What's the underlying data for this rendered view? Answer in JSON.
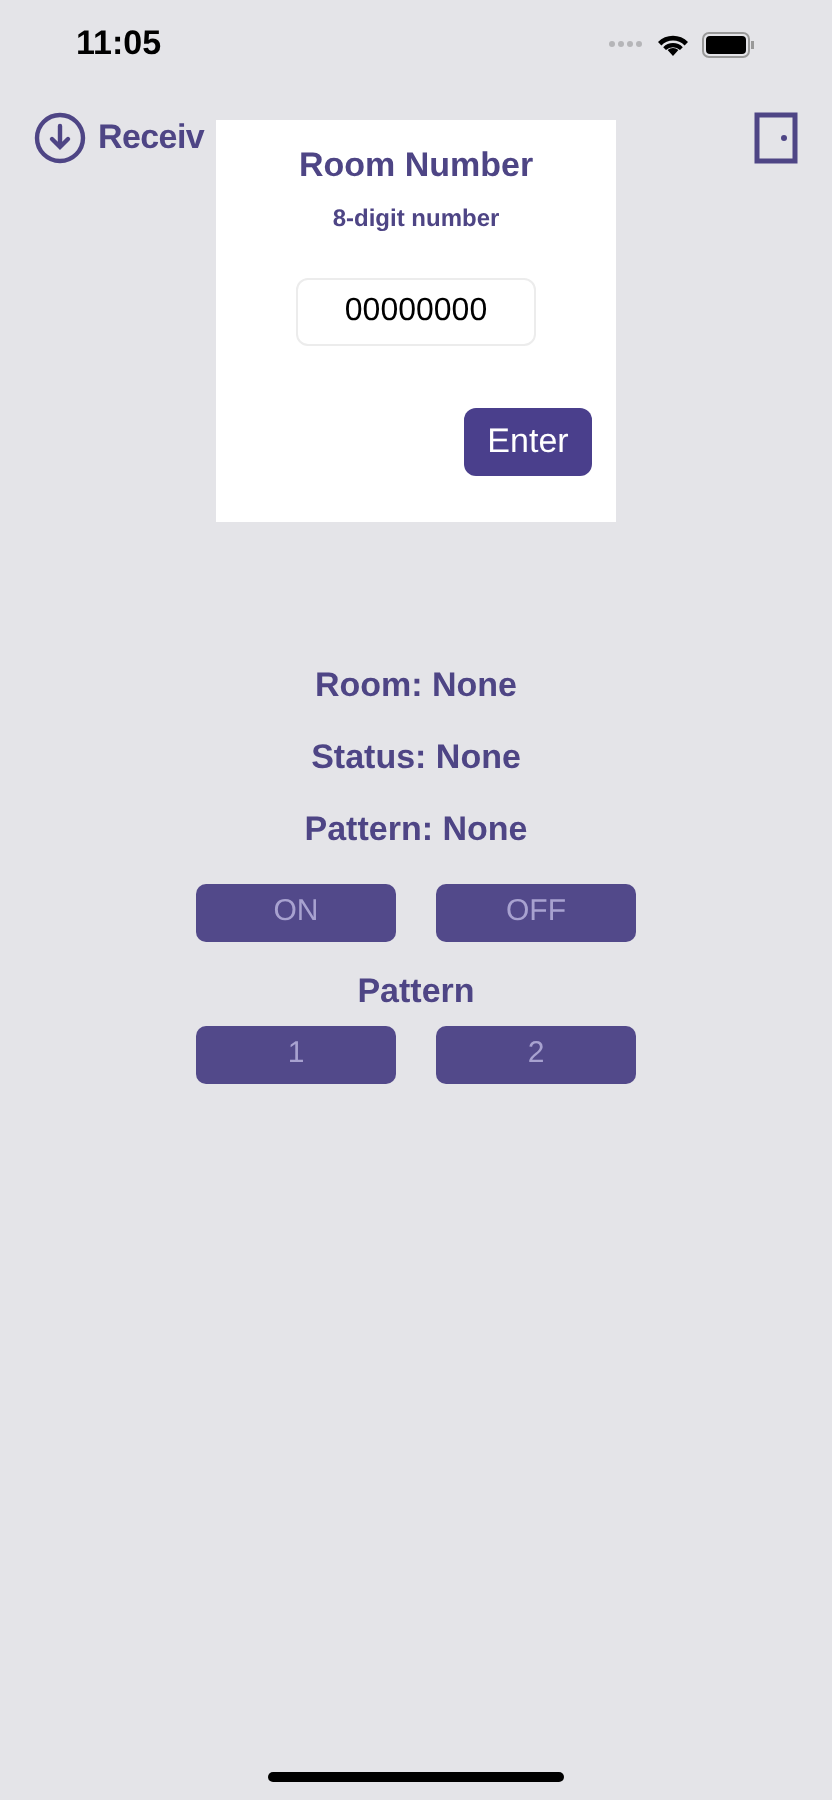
{
  "status_bar": {
    "time": "11:05"
  },
  "header": {
    "receive_label": "Receiv"
  },
  "dialog": {
    "title": "Room Number",
    "subtitle": "8-digit number",
    "field": {
      "value": "00000000"
    },
    "button": "Enter"
  },
  "info": [
    "Room: None",
    "Status: None",
    "Pattern: None"
  ],
  "power_buttons": [
    {
      "label": "ON",
      "disabled": true
    },
    {
      "label": "OFF",
      "disabled": true
    }
  ],
  "pattern_heading": "Pattern",
  "pattern_buttons": [
    {
      "label": "1",
      "disabled": true
    },
    {
      "label": "2",
      "disabled": true
    }
  ]
}
